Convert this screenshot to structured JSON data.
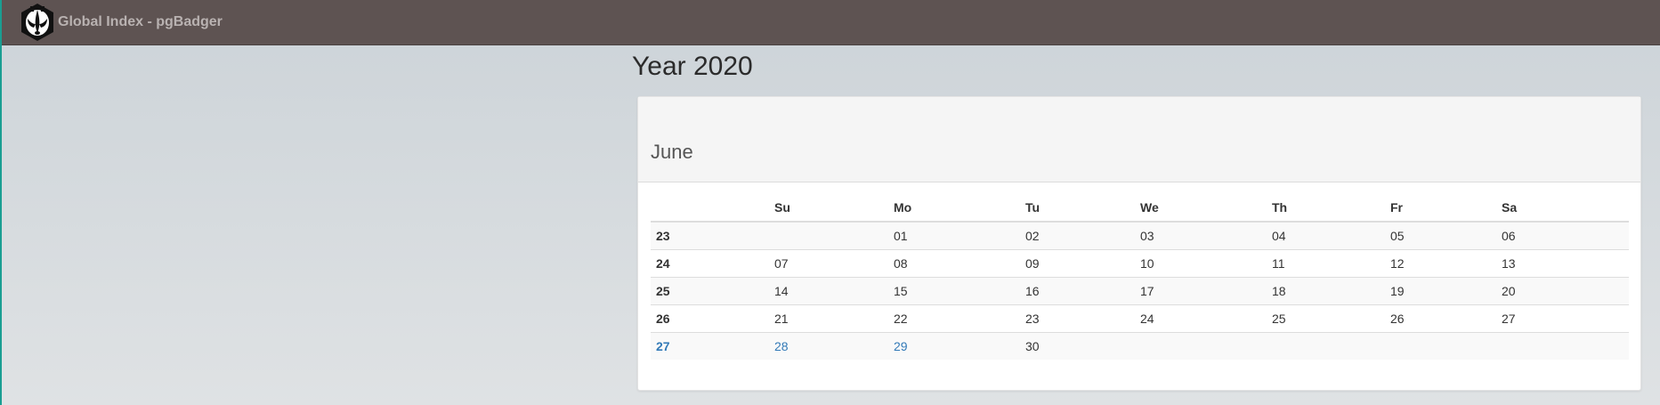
{
  "navbar": {
    "brand_label": "Global Index - pgBadger"
  },
  "page": {
    "title": "Year 2020"
  },
  "calendar": {
    "month": "June",
    "headers": [
      "",
      "Su",
      "Mo",
      "Tu",
      "We",
      "Th",
      "Fr",
      "Sa"
    ],
    "rows": [
      {
        "week": "23",
        "days": [
          "",
          "01",
          "02",
          "03",
          "04",
          "05",
          "06"
        ]
      },
      {
        "week": "24",
        "days": [
          "07",
          "08",
          "09",
          "10",
          "11",
          "12",
          "13"
        ]
      },
      {
        "week": "25",
        "days": [
          "14",
          "15",
          "16",
          "17",
          "18",
          "19",
          "20"
        ]
      },
      {
        "week": "26",
        "days": [
          "21",
          "22",
          "23",
          "24",
          "25",
          "26",
          "27"
        ]
      },
      {
        "week": "27",
        "days": [
          "28",
          "29",
          "30",
          "",
          "",
          "",
          ""
        ]
      }
    ]
  },
  "colors": {
    "navbar": "#5e5352",
    "link": "#337ab7",
    "accent_edge": "#1a9e92"
  },
  "icons": {
    "logo": "badger-logo-icon"
  }
}
